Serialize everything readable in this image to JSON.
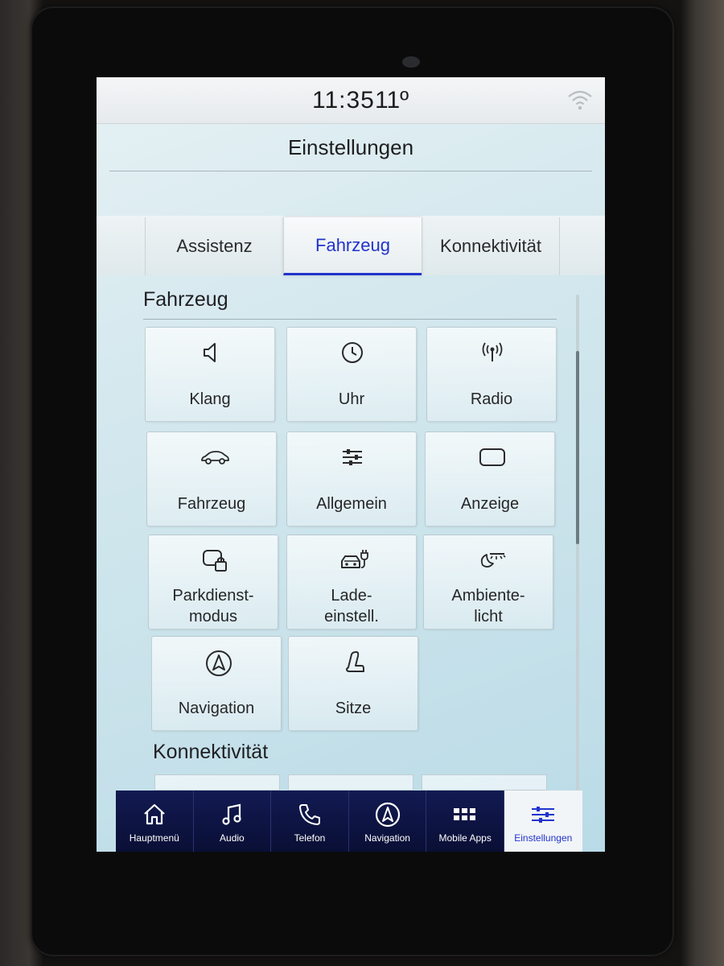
{
  "statusbar": {
    "time": "11:35",
    "temperature": "11º",
    "wifi_icon": "wifi-icon"
  },
  "header": {
    "title": "Einstellungen"
  },
  "tabs": [
    {
      "label": "Assistenz",
      "active": false
    },
    {
      "label": "Fahrzeug",
      "active": true
    },
    {
      "label": "Konnektivität",
      "active": false
    }
  ],
  "sections": {
    "vehicle_title": "Fahrzeug",
    "connectivity_title": "Konnektivität"
  },
  "tiles": [
    {
      "label": "Klang",
      "icon": "speaker-icon"
    },
    {
      "label": "Uhr",
      "icon": "clock-icon"
    },
    {
      "label": "Radio",
      "icon": "antenna-icon"
    },
    {
      "label": "Fahrzeug",
      "icon": "car-icon"
    },
    {
      "label": "Allgemein",
      "icon": "sliders-icon"
    },
    {
      "label": "Anzeige",
      "icon": "display-icon"
    },
    {
      "label_line1": "Parkdienst-",
      "label_line2": "modus",
      "icon": "valet-lock-icon"
    },
    {
      "label_line1": "Lade-",
      "label_line2": "einstell.",
      "icon": "charging-car-icon"
    },
    {
      "label_line1": "Ambiente-",
      "label_line2": "licht",
      "icon": "ambient-light-icon"
    },
    {
      "label": "Navigation",
      "icon": "navigation-icon"
    },
    {
      "label": "Sitze",
      "icon": "seat-icon"
    }
  ],
  "navbar": [
    {
      "label": "Hauptmenü",
      "icon": "home-icon",
      "active": false
    },
    {
      "label": "Audio",
      "icon": "music-note-icon",
      "active": false
    },
    {
      "label": "Telefon",
      "icon": "phone-icon",
      "active": false
    },
    {
      "label": "Navigation",
      "icon": "navigation-icon",
      "active": false
    },
    {
      "label": "Mobile Apps",
      "icon": "apps-grid-icon",
      "active": false
    },
    {
      "label": "Einstellungen",
      "icon": "settings-sliders-icon",
      "active": true
    }
  ],
  "colors": {
    "accent": "#2233cc",
    "navbar_bg": "#0a0f35",
    "screen_bg": "#c7e1ea"
  }
}
